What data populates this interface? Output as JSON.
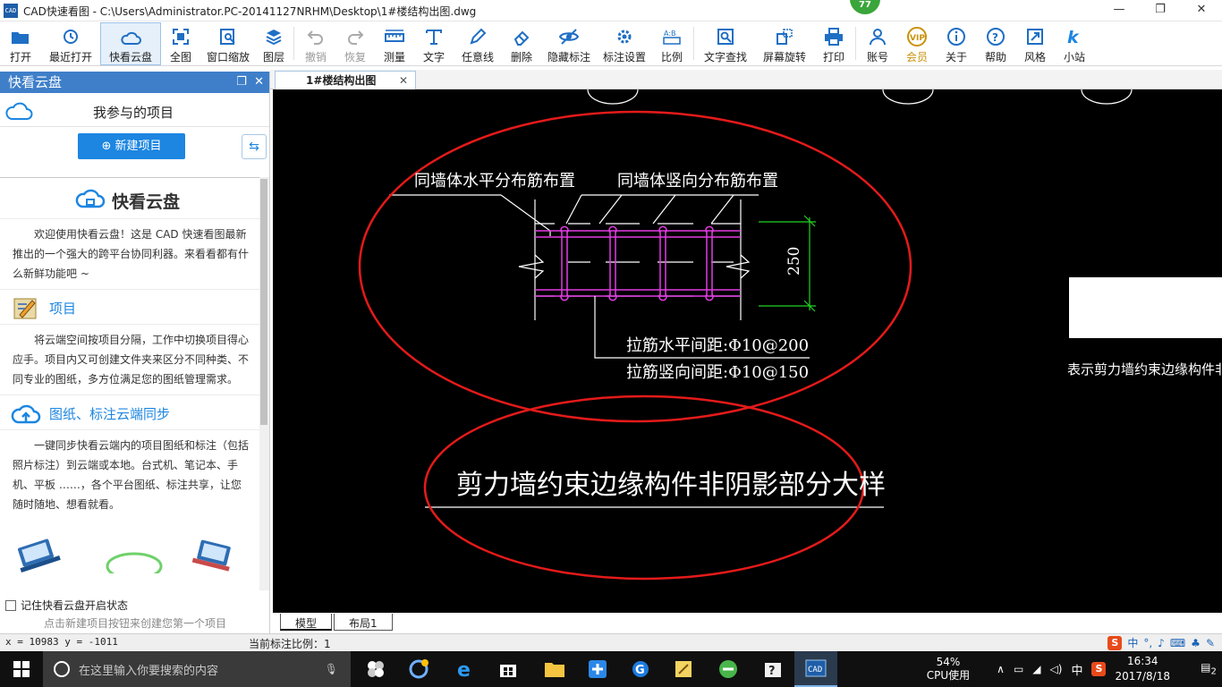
{
  "window": {
    "icon_text": "CAD",
    "title": "CAD快速看图 - C:\\Users\\Administrator.PC-20141127NRHM\\Desktop\\1#楼结构出图.dwg",
    "badge": "77",
    "minimize": "—",
    "restore": "❐",
    "close": "✕"
  },
  "toolbar": {
    "open": "打开",
    "recent": "最近打开",
    "cloud": "快看云盘",
    "fit": "全图",
    "window_zoom": "窗口缩放",
    "layers": "图层",
    "undo": "撤销",
    "redo": "恢复",
    "measure": "测量",
    "text": "文字",
    "freehand": "任意线",
    "erase": "删除",
    "hide_marks": "隐藏标注",
    "mark_settings": "标注设置",
    "scale": "比例",
    "text_search": "文字查找",
    "rotate_screen": "屏幕旋转",
    "print": "打印",
    "account": "账号",
    "member": "会员",
    "about": "关于",
    "help": "帮助",
    "style": "风格",
    "station": "小站",
    "colors": {
      "accent": "#1c86e1",
      "member": "#c9920a"
    }
  },
  "side_panel": {
    "title": "快看云盘",
    "my_projects": "我参与的项目",
    "new_project": "新建项目",
    "brand": "快看云盘",
    "intro": "欢迎使用快看云盘！这是 CAD 快速看图最新推出的一个强大的跨平台协同利器。来看看都有什么新鲜功能吧 ~",
    "section1_title": "项目",
    "section1_text": "将云端空间按项目分隔，工作中切换项目得心应手。项目内又可创建文件夹来区分不同种类、不同专业的图纸，多方位满足您的图纸管理需求。",
    "section2_title": "图纸、标注云端同步",
    "section2_text": "一键同步快看云端内的项目图纸和标注（包括照片标注）到云端或本地。台式机、笔记本、手机、平板 ……，各个平台图纸、标注共享，让您随时随地、想看就看。",
    "remember": "记住快看云盘开启状态",
    "hint": "点击新建项目按钮来创建您第一个项目"
  },
  "drawing_tab": {
    "label": "1#楼结构出图",
    "close": "✕"
  },
  "drawing": {
    "label_horizontal": "同墙体水平分布筋布置",
    "label_vertical": "同墙体竖向分布筋布置",
    "dimension": "250",
    "tie_horizontal": "拉筋水平间距:Φ10@200",
    "tie_vertical": "拉筋竖向间距:Φ10@150",
    "side_note": "表示剪力墙约束边缘构件非阴影部",
    "caption": "剪力墙约束边缘构件非阴影部分大样"
  },
  "layout_tabs": {
    "model": "模型",
    "layout1": "布局1"
  },
  "status": {
    "coords": "x = 10983 y = -1011",
    "scale": "当前标注比例：1",
    "ime_lang": "中"
  },
  "taskbar": {
    "search_placeholder": "在这里输入你要搜索的内容",
    "cpu_percent": "54%",
    "cpu_label": "CPU使用",
    "ime": "中",
    "time": "16:34",
    "date": "2017/8/18",
    "notifications": "2"
  }
}
